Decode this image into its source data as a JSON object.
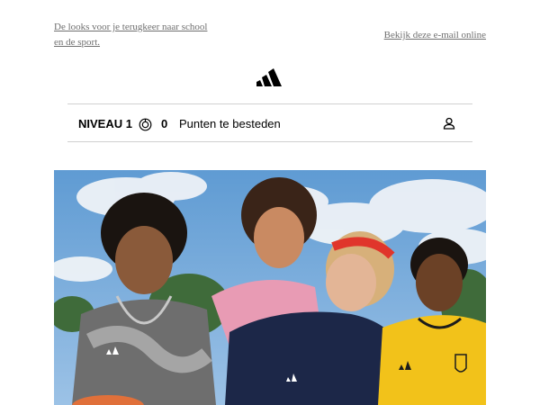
{
  "header": {
    "preheader_text": "De looks voor je terugkeer naar school en de sport.",
    "view_online_text": "Bekijk deze e-mail online"
  },
  "brand": {
    "logo_icon": "adidas-logo-icon"
  },
  "loyalty": {
    "level_label": "NIVEAU 1",
    "points_icon": "points-icon",
    "points_value": "0",
    "points_label": "Punten te besteden",
    "account_icon": "user-account-icon"
  },
  "hero": {
    "image_description_icon": "hero-image",
    "colors": {
      "sky": "#6fa6d8",
      "cloud": "#e8eef5",
      "jersey_yellow": "#f2c21a",
      "headband_red": "#e0352b",
      "navy": "#1c2748",
      "pink": "#e89bb4"
    }
  },
  "colors": {
    "link_gray": "#6f6f6f",
    "divider": "#d0d0d0",
    "text": "#000000"
  }
}
